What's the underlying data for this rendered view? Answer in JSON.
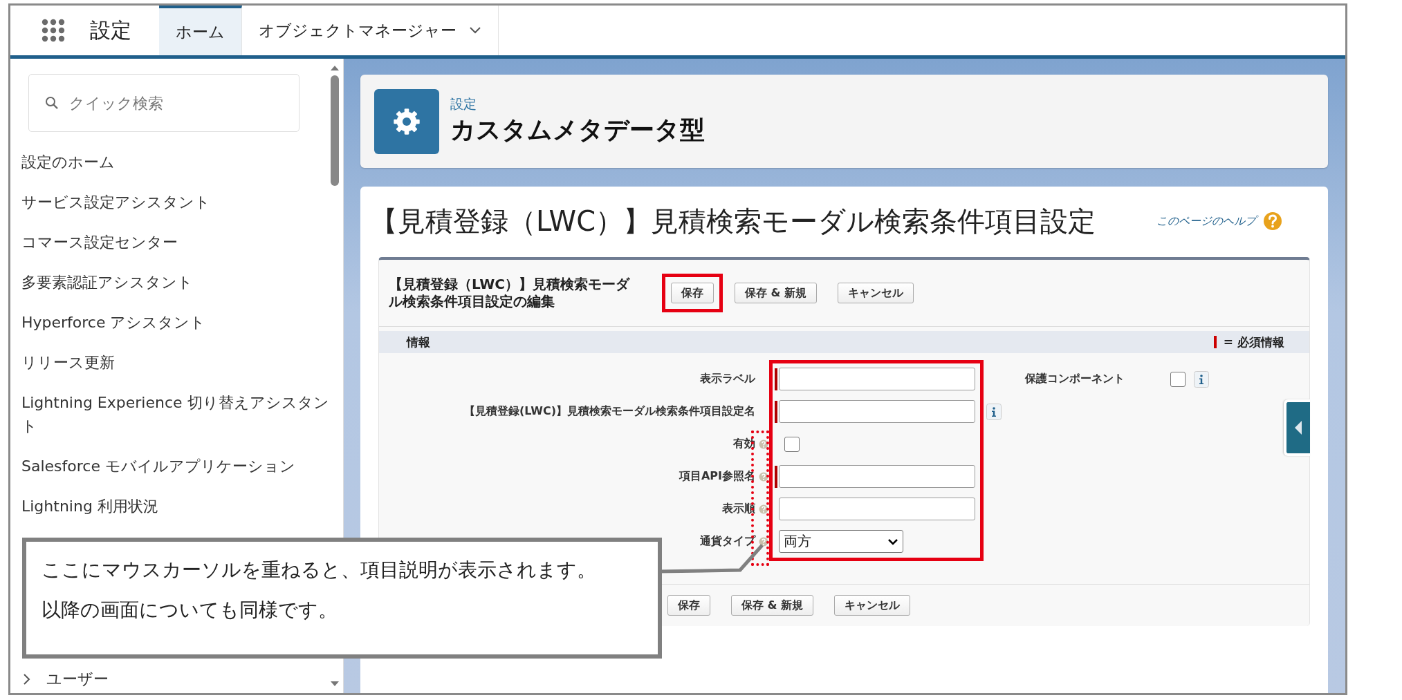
{
  "app_bar": {
    "title": "設定",
    "tabs": [
      {
        "label": "ホーム",
        "selected": true,
        "dropdown": false
      },
      {
        "label": "オブジェクトマネージャー",
        "selected": false,
        "dropdown": true
      }
    ]
  },
  "sidebar": {
    "search": {
      "placeholder": "クイック検索"
    },
    "items": [
      {
        "label": "設定のホーム",
        "kind": "link"
      },
      {
        "label": "サービス設定アシスタント",
        "kind": "link"
      },
      {
        "label": "コマース設定センター",
        "kind": "link"
      },
      {
        "label": "多要素認証アシスタント",
        "kind": "link"
      },
      {
        "label": "Hyperforce アシスタント",
        "kind": "link"
      },
      {
        "label": "リリース更新",
        "kind": "link"
      },
      {
        "label": "Lightning Experience 切り替えアシスタント",
        "kind": "link"
      },
      {
        "label": "Salesforce モバイルアプリケーション",
        "kind": "link"
      },
      {
        "label": "Lightning 利用状況",
        "kind": "link"
      },
      {
        "label": "ユーザー",
        "kind": "group",
        "expanded": false
      }
    ]
  },
  "header": {
    "breadcrumb": "設定",
    "title": "カスタムメタデータ型"
  },
  "page": {
    "title": "【見積登録（LWC）】見積検索モーダル検索条件項目設定",
    "help_link": "このページのヘルプ"
  },
  "form": {
    "title": "【見積登録（LWC）】見積検索モーダル検索条件項目設定の編集",
    "buttons_top": [
      {
        "label": "保存",
        "highlighted": true
      },
      {
        "label": "保存 & 新規",
        "highlighted": false
      },
      {
        "label": "キャンセル",
        "highlighted": false
      }
    ],
    "section": "情報",
    "required_legend": "= 必須情報",
    "fields": [
      {
        "label": "表示ラベル",
        "kind": "text",
        "required": true,
        "help": false,
        "info": false
      },
      {
        "label": "【見積登録(LWC)】見積検索モーダル検索条件項目設定名",
        "kind": "text",
        "required": true,
        "help": false,
        "info": true
      },
      {
        "label": "有効",
        "kind": "checkbox",
        "checked": false,
        "required": false,
        "help": true,
        "info": false
      },
      {
        "label": "項目API参照名",
        "kind": "text",
        "required": true,
        "help": true,
        "info": false
      },
      {
        "label": "表示順",
        "kind": "text",
        "required": false,
        "help": true,
        "info": false
      },
      {
        "label": "通貨タイプ",
        "kind": "select",
        "value": "両方",
        "required": false,
        "help": true,
        "info": false
      }
    ],
    "side_field": {
      "label": "保護コンポーネント",
      "kind": "checkbox",
      "checked": false,
      "info": true
    },
    "buttons_bottom": [
      {
        "label": "保存",
        "highlighted": false
      },
      {
        "label": "保存 & 新規",
        "highlighted": false
      },
      {
        "label": "キャンセル",
        "highlighted": false
      }
    ]
  },
  "callout": {
    "lines": [
      "ここにマウスカーソルを重ねると、項目説明が表示されます。",
      "以降の画面についても同様です。"
    ]
  }
}
